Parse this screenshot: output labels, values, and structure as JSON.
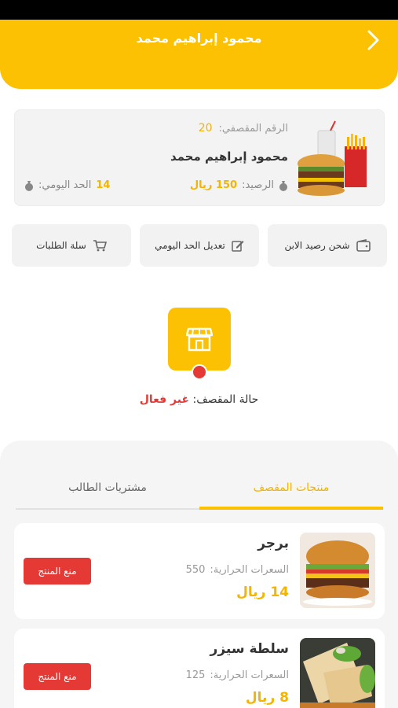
{
  "header": {
    "title": "محمود إبراهيم محمد"
  },
  "card": {
    "kiosk_number_label": "الرقم المقصفي:",
    "kiosk_number": "20",
    "name": "محمود إبراهيم محمد",
    "balance_label": "الرصيد:",
    "balance": "150 ريال",
    "daily_limit_label": "الحد اليومي:",
    "daily_limit": "14"
  },
  "actions": {
    "charge": "شحن رصيد الابن",
    "edit_limit": "تعديل الحد اليومي",
    "orders_cart": "سلة الطلبات"
  },
  "kiosk": {
    "status_label": "حالة المقصف:",
    "status_value": "غير فعال",
    "status_color": "#e53935"
  },
  "tabs": {
    "kiosk_products": "منتجات المقصف",
    "student_purchases": "مشتريات الطالب"
  },
  "products": [
    {
      "name": "برجر",
      "calories_label": "السعرات الحرارية:",
      "calories": "550",
      "price": "14 ريال",
      "ban_label": "منع المنتج"
    },
    {
      "name": "سلطة سيزر",
      "calories_label": "السعرات الحرارية:",
      "calories": "125",
      "price": "8 ريال",
      "ban_label": "منع المنتج"
    }
  ],
  "colors": {
    "accent": "#fcc102",
    "danger": "#e53935"
  }
}
